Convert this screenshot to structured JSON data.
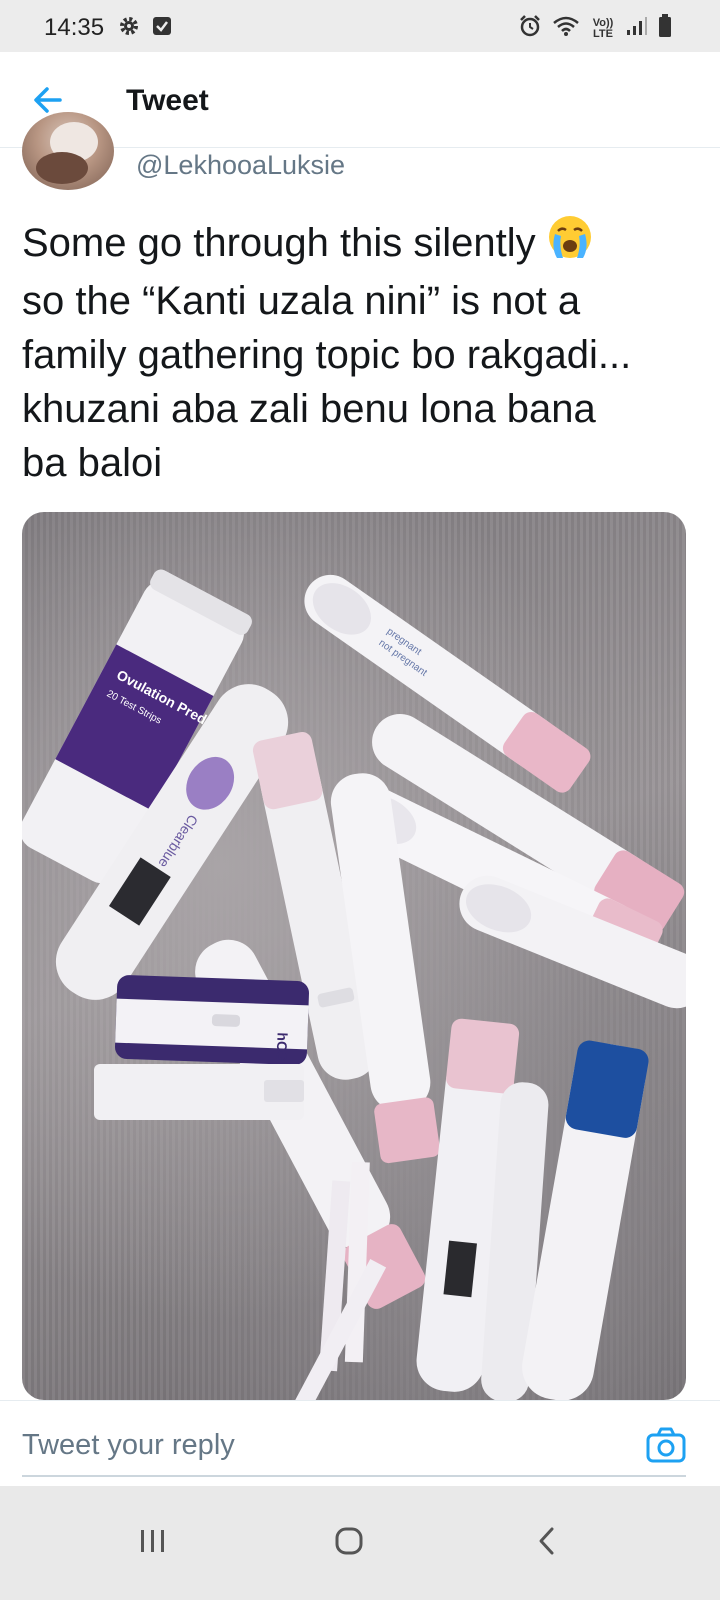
{
  "status_bar": {
    "time": "14:35",
    "network": "Vo)) LTE"
  },
  "header": {
    "title": "Tweet"
  },
  "tweet": {
    "handle": "@LekhooaLuksie",
    "lines": [
      "Some go through this silently",
      "so the “Kanti uzala nini” is not a",
      "family gathering topic bo rakgadi...",
      "khuzani aba zali benu lona bana",
      "ba baloi"
    ],
    "emoji": "crying-face",
    "media": {
      "ovulation_label": "Ovulation Pred",
      "ovulation_sub": "20 Test Strips",
      "brand": "Clearblue",
      "hcg": "hCG",
      "pregnant_label": "pregnant",
      "not_pregnant_label": "not pregnant"
    }
  },
  "reply": {
    "placeholder": "Tweet your reply"
  },
  "colors": {
    "accent": "#1da1f2",
    "text": "#14171a",
    "muted": "#657786"
  },
  "nav": {
    "recents": "recents-icon",
    "home": "home-icon",
    "back": "back-icon"
  }
}
